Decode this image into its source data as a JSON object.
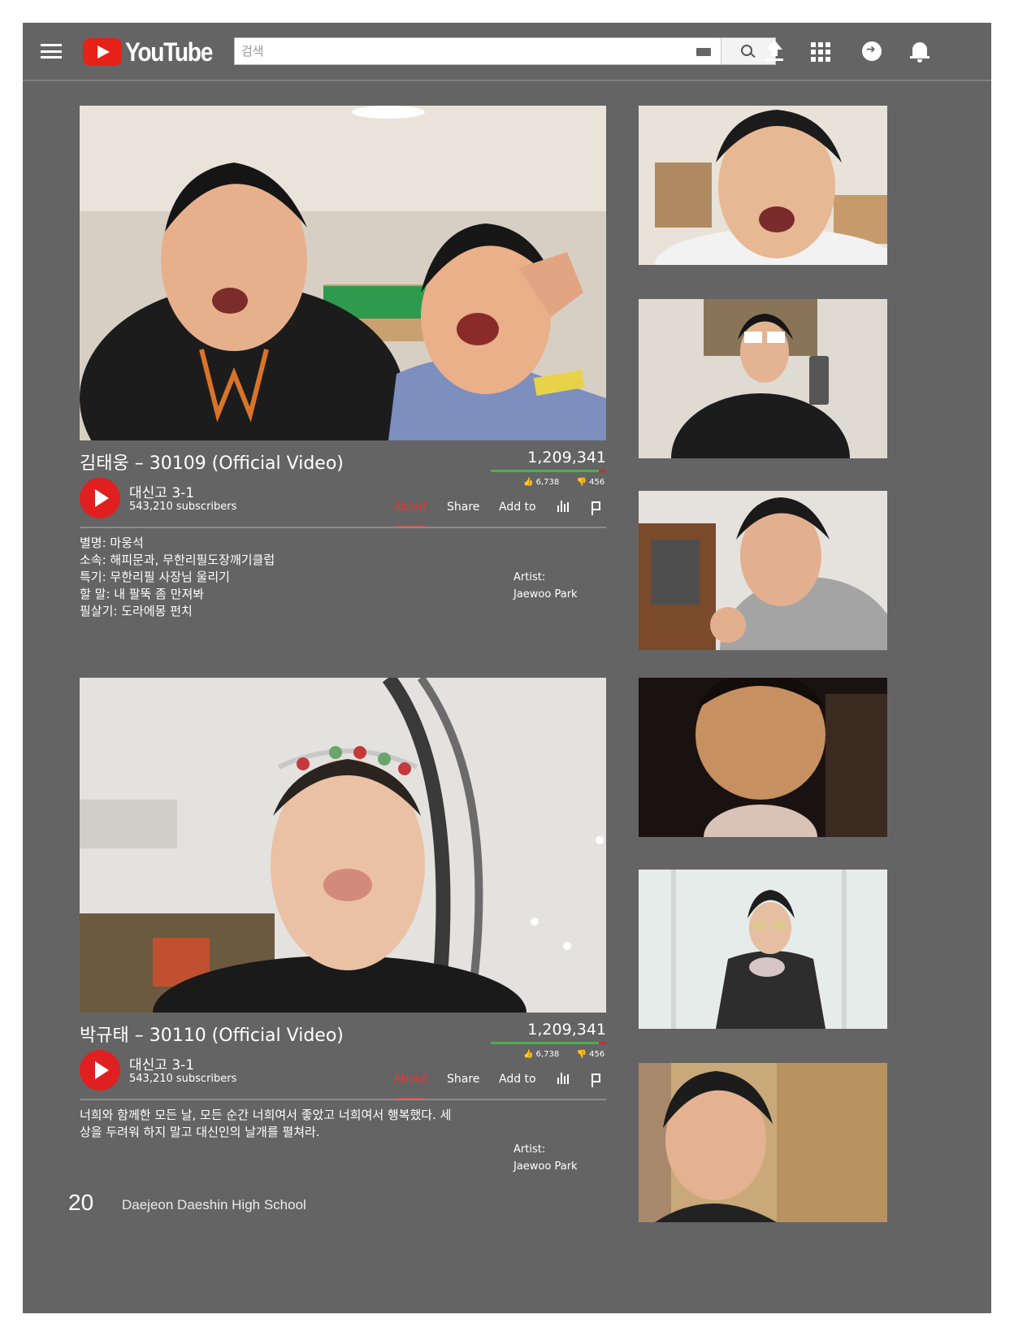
{
  "header": {
    "logo_text": "YouTube",
    "search_placeholder": "검색",
    "icons": [
      "menu-icon",
      "keyboard-icon",
      "search-icon",
      "upload-icon",
      "apps-icon",
      "messages-icon",
      "notifications-icon"
    ]
  },
  "colors": {
    "background": "#646464",
    "brand_red": "#e62117",
    "active_tab": "#e53935",
    "like_bar": "#4caf50",
    "dislike_bar": "#cc2b2b"
  },
  "videos": [
    {
      "title": "김태웅 – 30109 (Official Video)",
      "views": "1,209,341",
      "likes": "6,738",
      "dislikes": "456",
      "like_ratio": 0.94,
      "channel": "대신고 3-1",
      "subscribers": "543,210 subscribers",
      "tabs": [
        "About",
        "Share",
        "Add to"
      ],
      "active_tab": "About",
      "description": [
        "별명: 마웅석",
        "소속: 해피문과, 무한리필도장깨기클럽",
        "특기: 무한리필 사장님 울리기",
        "할 말: 내 팔뚝 좀 만져봐",
        "필살기: 도라에몽 펀치"
      ],
      "artist_label": "Artist:",
      "artist_name": "Jaewoo Park"
    },
    {
      "title": "박규태 – 30110 (Official Video)",
      "views": "1,209,341",
      "likes": "6,738",
      "dislikes": "456",
      "like_ratio": 0.94,
      "channel": "대신고 3-1",
      "subscribers": "543,210 subscribers",
      "tabs": [
        "About",
        "Share",
        "Add to"
      ],
      "active_tab": "About",
      "description": [
        "너희와 함께한 모든 날, 모든 순간 너희여서 좋았고 너희여서 행복했다. 세",
        "상을 두려워 하지 말고 대신인의 날개를 펼쳐라."
      ],
      "artist_label": "Artist:",
      "artist_name": "Jaewoo Park"
    }
  ],
  "footer": {
    "page_number": "20",
    "school": "Daejeon Daeshin High School"
  }
}
